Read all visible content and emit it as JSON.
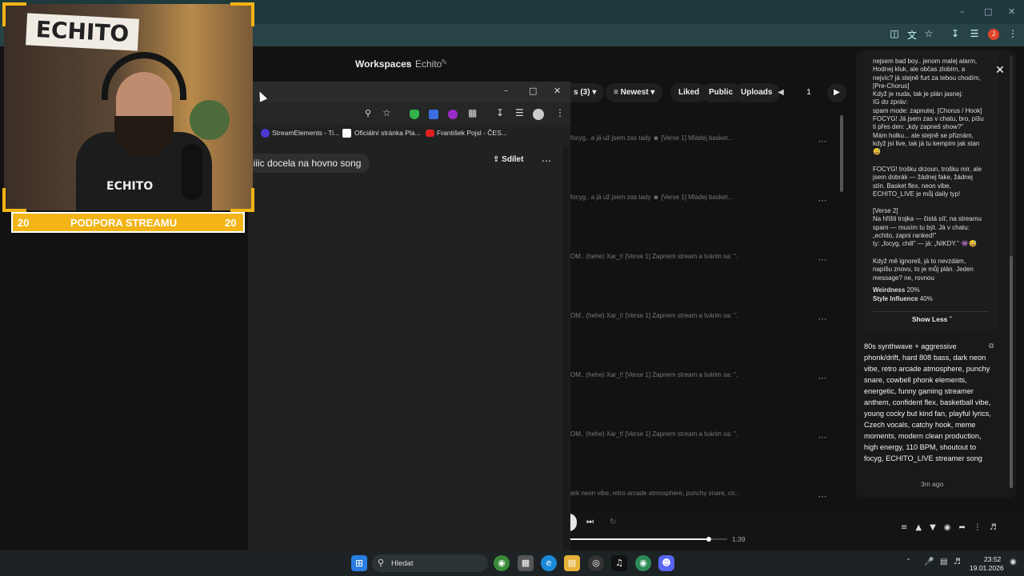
{
  "background_browser": {
    "crumbs": {
      "first": "Workspaces",
      "separator": ">",
      "second": "Echito"
    },
    "filters": {
      "likes_label": "s (3)",
      "sort_label": "Newest",
      "liked": "Liked",
      "public": "Public",
      "uploads": "Uploads",
      "page": "1"
    },
    "rows": [
      "focyg.. a já už jsem zas tady ☻ [Verse 1] Mladej basket...",
      "focyg.. a já už jsem zas tady ☻ [Verse 1] Mladej basket...",
      "OM.. (hehe) Xar_t! [Verse 1] Zapnem stream a tvárim sa: \"...",
      "OM.. (hehe) Xar_t! [Verse 1] Zapnem stream a tvárim sa: \"...",
      "OM.. (hehe) Xar_t! [Verse 1] Zapnem stream a tvárim sa: \"...",
      "OM.. (hehe) Xar_t! [Verse 1] Zapnem stream a tvárim sa: \"...",
      "ark neon vibe, retro arcade atmosphere, punchy snare, co..."
    ],
    "lyrics_block_1": "nejsem bad boy.. jenom malej alarm,\nHodnej kluk, ale občas zlobím, a\nnejvíc? já stejně furt za tebou chodím,\n[Pre-Chorus]\nKdyž je nuda, tak je plán jasnej:\nIG do zpráv:\nspam mode: zapnutej. [Chorus / Hook]\nFOCYG! Já jsem zas v chatu, bro, píšu\nti přes den: „kdy zapneš show?\"\nMám holku... ale stejně se přiznám,\nkdyž jsi live, tak já tu kempím jak stan\n😅",
    "lyrics_block_2": "FOCYG! trošku drzoun, trošku mír, ale\njsem dobrák — žádnej fake, žádnej\nstín. Basket flex, neon vibe,\nECHITO_LIVE je můj daily typ!",
    "lyrics_block_3": "[Verse 2]\nNa hřišti trojka — čistá síť, na streamu\nspam — musím tu být. Já v chatu:\n„echito, zapni ranked!\"\nty: „focyg, chill\" — já: „NIKDY.\" 👾😅",
    "lyrics_block_4": "Když mě ignoreš, já to nevzdám,\nnapíšu znovu, to je můj plán. Jeden\nmessage? ne, rovnou",
    "weirdness_label": "Weirdness",
    "weirdness_value": "20%",
    "style_influence_label": "Style Influence",
    "style_influence_value": "40%",
    "show_less": "Show Less",
    "style_prompt": "80s synthwave + aggressive phonk/drift, hard 808 bass, dark neon vibe, retro arcade atmosphere, punchy snare, cowbell phonk elements, energetic, funny gaming streamer anthem, confident flex, basketball vibe, young cocky but kind fan, playful lyrics, Czech vocals, catchy hook, meme moments, modern clean production, high energy, 110 BPM, shoutout to focyg, ECHITO_LIVE streamer song",
    "timestamp": "3m ago",
    "player_time": "1:39"
  },
  "front_browser": {
    "bookmarks": [
      {
        "label": "StreamElements - Ti...",
        "icon": "streamelements-icon"
      },
      {
        "label": "Oficiální stránka Pla...",
        "icon": "playstation-icon"
      },
      {
        "label": "František Pojsl - ČES...",
        "icon": "youtube-icon"
      }
    ],
    "song_title": "iiiic docela na hovno song",
    "share_label": "Sdílet"
  },
  "overlay": {
    "cam_logo": "ECHITO",
    "shirt_logo": "ECHITO",
    "support_left": "20",
    "support_label": "PODPORA STREAMU",
    "support_right": "20"
  },
  "taskbar": {
    "search_placeholder": "Hledat",
    "time": "23:52",
    "date": "19.01.2026"
  },
  "colors": {
    "accent_yellow": "#f2b416",
    "avatar_red": "#e0452b"
  }
}
